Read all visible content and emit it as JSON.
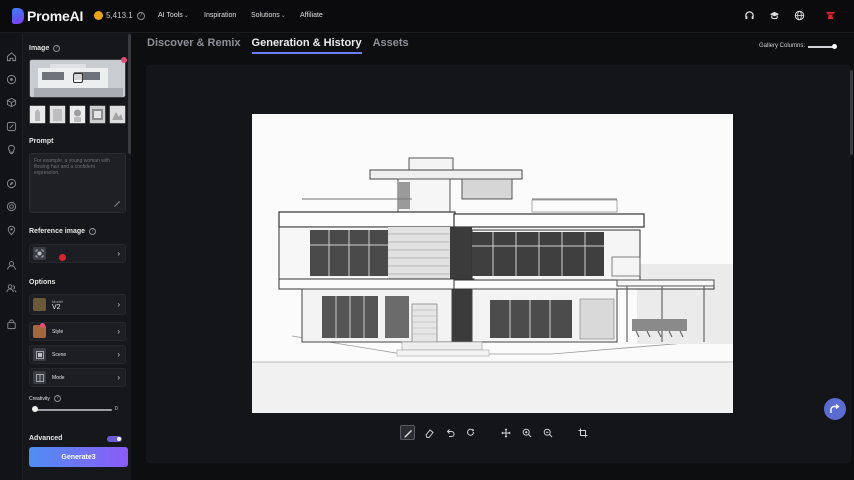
{
  "header": {
    "logo": "PromeAI",
    "credits": "5,413.1",
    "nav": [
      {
        "label": "AI Tools",
        "chevron": true
      },
      {
        "label": "Inspiration",
        "chevron": false
      },
      {
        "label": "Solutions",
        "chevron": true
      },
      {
        "label": "Affiliate",
        "chevron": false
      }
    ],
    "icons": [
      "headset-icon",
      "graduation-cap-icon",
      "globe-icon",
      "brand-badge-icon"
    ]
  },
  "rail": {
    "icons": [
      "home-icon",
      "explore-icon",
      "cube-icon",
      "edit-image-icon",
      "lightbulb-icon",
      "compass-icon",
      "target-icon",
      "location-pin-icon",
      "user-icon",
      "team-icon",
      "bag-icon"
    ]
  },
  "panel": {
    "image_label": "Image",
    "prompt_label": "Prompt",
    "prompt_placeholder": "For example, a young woman with flowing hair and a confident expression.",
    "reference_label": "Reference image",
    "options_label": "Options",
    "model_label": "Model",
    "model_value": "V2",
    "style_label": "Style",
    "scene_label": "Scene",
    "mode_label": "Mode",
    "creativity_label": "Creativity",
    "creativity_value": "0",
    "advanced_label": "Advanced",
    "generate_label": "Generate3"
  },
  "tabs": [
    {
      "label": "Discover & Remix",
      "active": false
    },
    {
      "label": "Generation & History",
      "active": true
    },
    {
      "label": "Assets",
      "active": false
    }
  ],
  "gallery_columns_label": "Gallery Columns:",
  "toolbar": [
    "brush-icon",
    "eraser-icon",
    "undo-icon",
    "redo-icon",
    "move-icon",
    "zoom-in-icon",
    "zoom-out-icon",
    "crop-icon"
  ],
  "colors": {
    "accent": "#6b7cf6",
    "generate_start": "#4f8ef2",
    "generate_end": "#8b5cf6",
    "coin": "#e8a317"
  }
}
